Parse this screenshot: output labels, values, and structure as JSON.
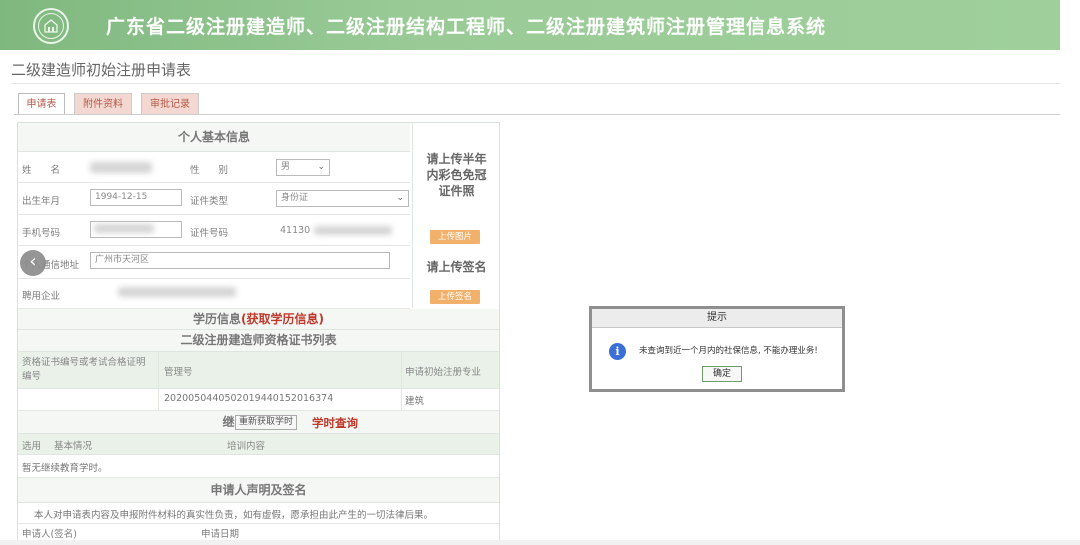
{
  "header": {
    "system_title": "广东省二级注册建造师、二级注册结构工程师、二级注册建筑师注册管理信息系统",
    "logo_icon": "government-emblem-icon"
  },
  "page": {
    "title": "二级建造师初始注册申请表"
  },
  "tabs": [
    {
      "label": "申请表",
      "active": true
    },
    {
      "label": "附件资料",
      "active": false
    },
    {
      "label": "审批记录",
      "active": false
    }
  ],
  "personal": {
    "section_title": "个人基本信息",
    "name_label": "姓　　名",
    "gender_label": "性　　别",
    "gender_value": "男",
    "birth_label": "出生年月",
    "birth_value": "1994-12-15",
    "id_type_label": "证件类型",
    "id_type_value": "身份证",
    "phone_label": "手机号码",
    "id_no_label": "证件号码",
    "id_no_value": "41130",
    "address_label": "个人通信地址",
    "address_value": "广州市天河区",
    "employer_label": "聘用企业"
  },
  "photo": {
    "upload_photo_text": "请上传半年内彩色免冠证件照",
    "upload_photo_button": "上传图片",
    "upload_sign_text": "请上传签名",
    "upload_sign_button": "上传签名"
  },
  "education": {
    "label": "学历信息",
    "link": "(获取学历信息)"
  },
  "cert_list": {
    "title": "二级注册建造师资格证书列表",
    "headers": [
      "资格证书编号或考试合格证明编号",
      "管理号",
      "申请初始注册专业"
    ],
    "rows": [
      {
        "cert_no": "",
        "manage_no": "20200504405020194401520163​74",
        "major": "建筑"
      }
    ]
  },
  "continuing_edu": {
    "title": "继续教育情况",
    "refresh_button": "重新获取学时",
    "query_link": "学时查询",
    "headers": [
      "选用",
      "基本情况",
      "培训内容"
    ],
    "empty_text": "暂无继续教育学时。"
  },
  "declaration": {
    "title": "申请人声明及签名",
    "text": "本人对申请表内容及申报附件材料的真实性负责，如有虚假，愿承担由此产生的一切法律后果。",
    "sign_label": "申请人(签名)",
    "date_label": "申请日期"
  },
  "dialog": {
    "title": "提示",
    "icon": "info-icon",
    "message": "未查询到近一个月内的社保信息, 不能办理业务!",
    "ok_label": "确定"
  },
  "colors": {
    "banner": "#8fc38f",
    "tab_inactive": "#f3d8d1",
    "upload_button": "#f2b16a",
    "link_red": "#c0392b"
  }
}
